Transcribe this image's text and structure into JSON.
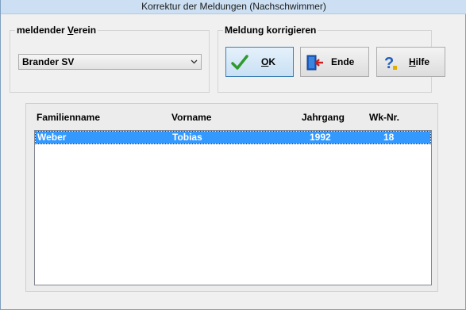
{
  "window": {
    "title": "Korrektur der Meldungen   (Nachschwimmer)"
  },
  "verein_group": {
    "legend_pre": "meldender ",
    "legend_u": "V",
    "legend_post": "erein",
    "selected_value": "Brander SV"
  },
  "actions_group": {
    "legend": "Meldung korrigieren",
    "ok_u": "O",
    "ok_post": "K",
    "ende": "Ende",
    "hilfe_u": "H",
    "hilfe_post": "ilfe"
  },
  "list": {
    "columns": [
      "Familienname",
      "Vorname",
      "Jahrgang",
      "Wk-Nr."
    ],
    "rows": [
      {
        "familienname": "Weber",
        "vorname": "Tobias",
        "jahrgang": "1992",
        "wknr": "18"
      }
    ]
  },
  "colors": {
    "selection": "#3399ff",
    "titlebar": "#cde0f3"
  },
  "icons": {
    "ok": "checkmark-icon",
    "ende": "exit-door-icon",
    "hilfe": "help-question-icon",
    "dropdown": "chevron-down-icon"
  }
}
